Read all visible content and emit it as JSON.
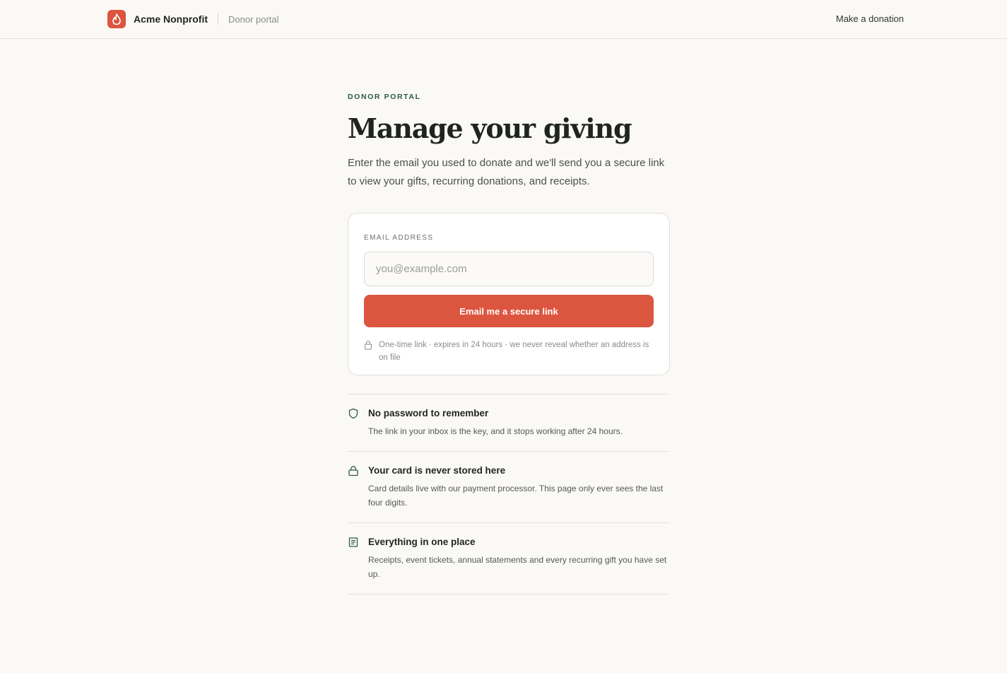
{
  "header": {
    "brand_name": "Acme Nonprofit",
    "brand_sub": "Donor portal",
    "donate_link": "Make a donation",
    "logo_icon": "flame-icon",
    "accent_color": "#dc553f"
  },
  "main": {
    "eyebrow": "DONOR PORTAL",
    "title": "Manage your giving",
    "lead": "Enter the email you used to donate and we'll send you a secure link to view your gifts, recurring donations, and receipts."
  },
  "form": {
    "email_label": "EMAIL ADDRESS",
    "email_value": "",
    "email_placeholder": "you@example.com",
    "submit_label": "Email me a secure link",
    "note_icon": "lock-icon",
    "note": "One-time link · expires in 24 hours · we never reveal whether an address is on file"
  },
  "features": [
    {
      "icon": "shield-icon",
      "title": "No password to remember",
      "desc": "The link in your inbox is the key, and it stops working after 24 hours."
    },
    {
      "icon": "lock-icon",
      "title": "Your card is never stored here",
      "desc": "Card details live with our payment processor. This page only ever sees the last four digits."
    },
    {
      "icon": "receipt-icon",
      "title": "Everything in one place",
      "desc": "Receipts, event tickets, annual statements and every recurring gift you have set up."
    }
  ]
}
